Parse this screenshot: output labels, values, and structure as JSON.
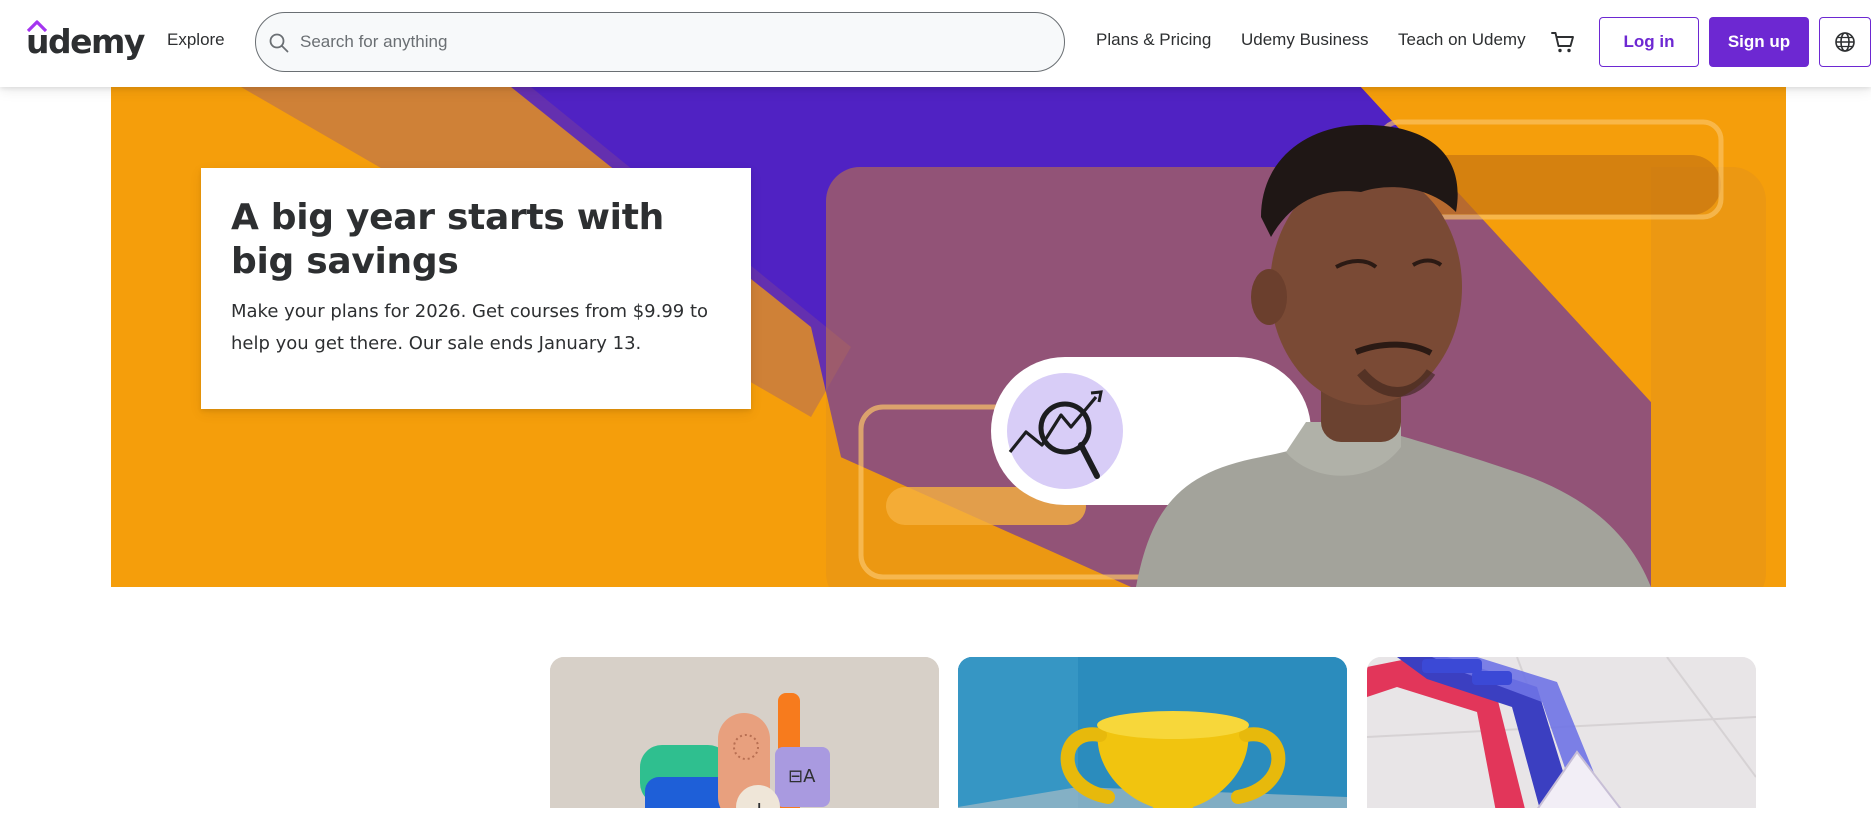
{
  "header": {
    "logo_text": "udemy",
    "explore_label": "Explore",
    "search": {
      "placeholder": "Search for anything",
      "value": ""
    },
    "nav": {
      "plans_pricing": "Plans & Pricing",
      "udemy_business": "Udemy Business",
      "teach": "Teach on Udemy"
    },
    "login_label": "Log in",
    "signup_label": "Sign up",
    "icons": [
      "search-icon",
      "cart-icon",
      "globe-icon"
    ]
  },
  "hero": {
    "title": "A big year starts with big savings",
    "text": "Make your plans for 2026. Get courses from $9.99 to help you get there. Our sale ends January 13."
  },
  "colors": {
    "brand_purple": "#6d28d2",
    "hero_orange": "#f59e0b",
    "hero_purple": "#5022c3",
    "text_dark": "#2d2f31"
  }
}
